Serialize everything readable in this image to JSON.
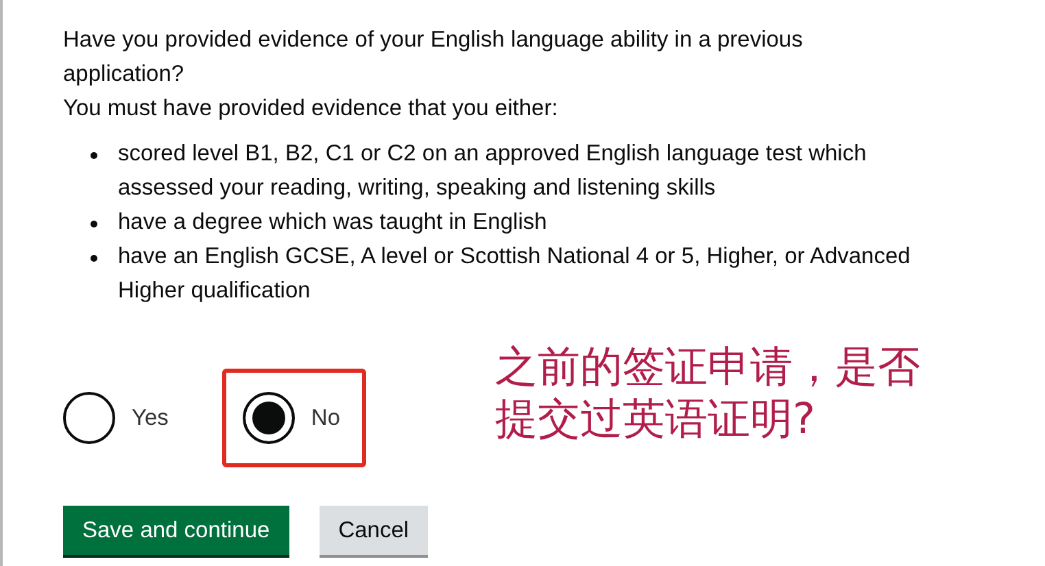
{
  "question": "Have you provided evidence of your English language ability in a previous application?",
  "hint": "You must have provided evidence that you either:",
  "requirements": [
    "scored level B1, B2, C1 or C2 on an approved English language test which assessed your reading, writing, speaking and listening skills",
    "have a degree which was taught in English",
    "have an English GCSE, A level or Scottish National 4 or 5, Higher, or Advanced Higher qualification"
  ],
  "options": [
    {
      "label": "Yes",
      "selected": false,
      "highlighted": false
    },
    {
      "label": "No",
      "selected": true,
      "highlighted": true
    }
  ],
  "annotation": {
    "lines": [
      "之前的签证申请，是否",
      "提交过英语证明?"
    ]
  },
  "buttons": [
    {
      "label": "Save and continue",
      "kind": "primary"
    },
    {
      "label": "Cancel",
      "kind": "secondary"
    }
  ]
}
